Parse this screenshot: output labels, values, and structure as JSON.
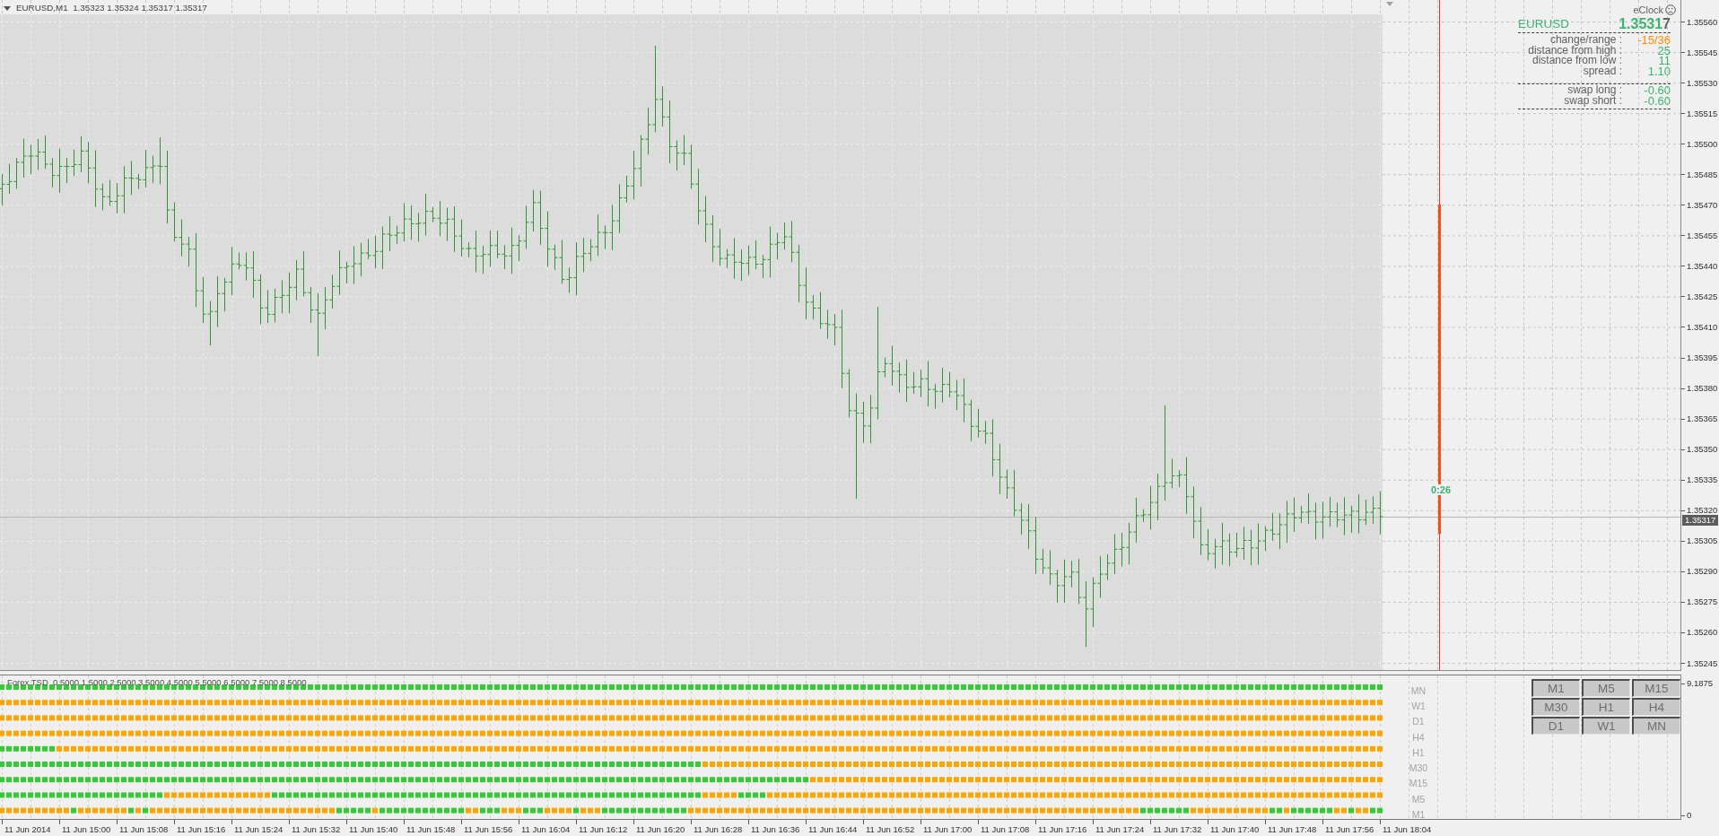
{
  "chart_header": {
    "symbol_line": "EURUSD,M1  1.35323 1.35324 1.35317 1.35317"
  },
  "info_panel": {
    "brand": "eClock",
    "symbol": "EURUSD",
    "price": "1.35317",
    "groups": [
      {
        "rows": [
          {
            "label": "change/range :",
            "value": "-15/36",
            "color": "#ff8c00"
          },
          {
            "label": "distance from high :",
            "value": "25",
            "color": "#3cb371"
          },
          {
            "label": "distance from low :",
            "value": "11",
            "color": "#3cb371"
          },
          {
            "label": "spread :",
            "value": "1.10",
            "color": "#3cb371"
          }
        ]
      },
      {
        "rows": [
          {
            "label": "swap long :",
            "value": "-0.60",
            "color": "#3cb371"
          },
          {
            "label": "swap short :",
            "value": "-0.60",
            "color": "#3cb371"
          }
        ]
      }
    ]
  },
  "countdown": "0:26",
  "price_axis": {
    "labels": [
      "1.35560",
      "1.35545",
      "1.35530",
      "1.35515",
      "1.35500",
      "1.35485",
      "1.35470",
      "1.35455",
      "1.35440",
      "1.35425",
      "1.35410",
      "1.35395",
      "1.35380",
      "1.35365",
      "1.35350",
      "1.35335",
      "1.35320",
      "1.35305",
      "1.35290",
      "1.35275",
      "1.35260",
      "1.35245"
    ],
    "current_price": "1.35317"
  },
  "indicator": {
    "title": "Forex TSD  0.5000 1.5000 2.5000 3.5000 4.5000 5.5000 6.5000 7.5000 8.5000",
    "rows": [
      {
        "label": "MN"
      },
      {
        "label": "W1"
      },
      {
        "label": "D1"
      },
      {
        "label": "H4"
      },
      {
        "label": "H1"
      },
      {
        "label": "M30"
      },
      {
        "label": "M15"
      },
      {
        "label": "M5"
      },
      {
        "label": "M1"
      }
    ],
    "timeframe_buttons": [
      {
        "label": "M1",
        "selected": false
      },
      {
        "label": "M5",
        "selected": false
      },
      {
        "label": "M15",
        "selected": false
      },
      {
        "label": "M30",
        "selected": false
      },
      {
        "label": "H1",
        "selected": false
      },
      {
        "label": "H4",
        "selected": false
      },
      {
        "label": "D1",
        "selected": false
      },
      {
        "label": "W1",
        "selected": false
      },
      {
        "label": "MN",
        "selected": false
      }
    ],
    "scale_labels": [
      "9.1875",
      "0"
    ]
  },
  "time_axis": {
    "labels": [
      "11 Jun 2014",
      "11 Jun 15:00",
      "11 Jun 15:08",
      "11 Jun 15:16",
      "11 Jun 15:24",
      "11 Jun 15:32",
      "11 Jun 15:40",
      "11 Jun 15:48",
      "11 Jun 15:56",
      "11 Jun 16:04",
      "11 Jun 16:12",
      "11 Jun 16:20",
      "11 Jun 16:28",
      "11 Jun 16:36",
      "11 Jun 16:44",
      "11 Jun 16:52",
      "11 Jun 17:00",
      "11 Jun 17:08",
      "11 Jun 17:16",
      "11 Jun 17:24",
      "11 Jun 17:32",
      "11 Jun 17:40",
      "11 Jun 17:48",
      "11 Jun 17:56",
      "11 Jun 18:04"
    ]
  }
}
